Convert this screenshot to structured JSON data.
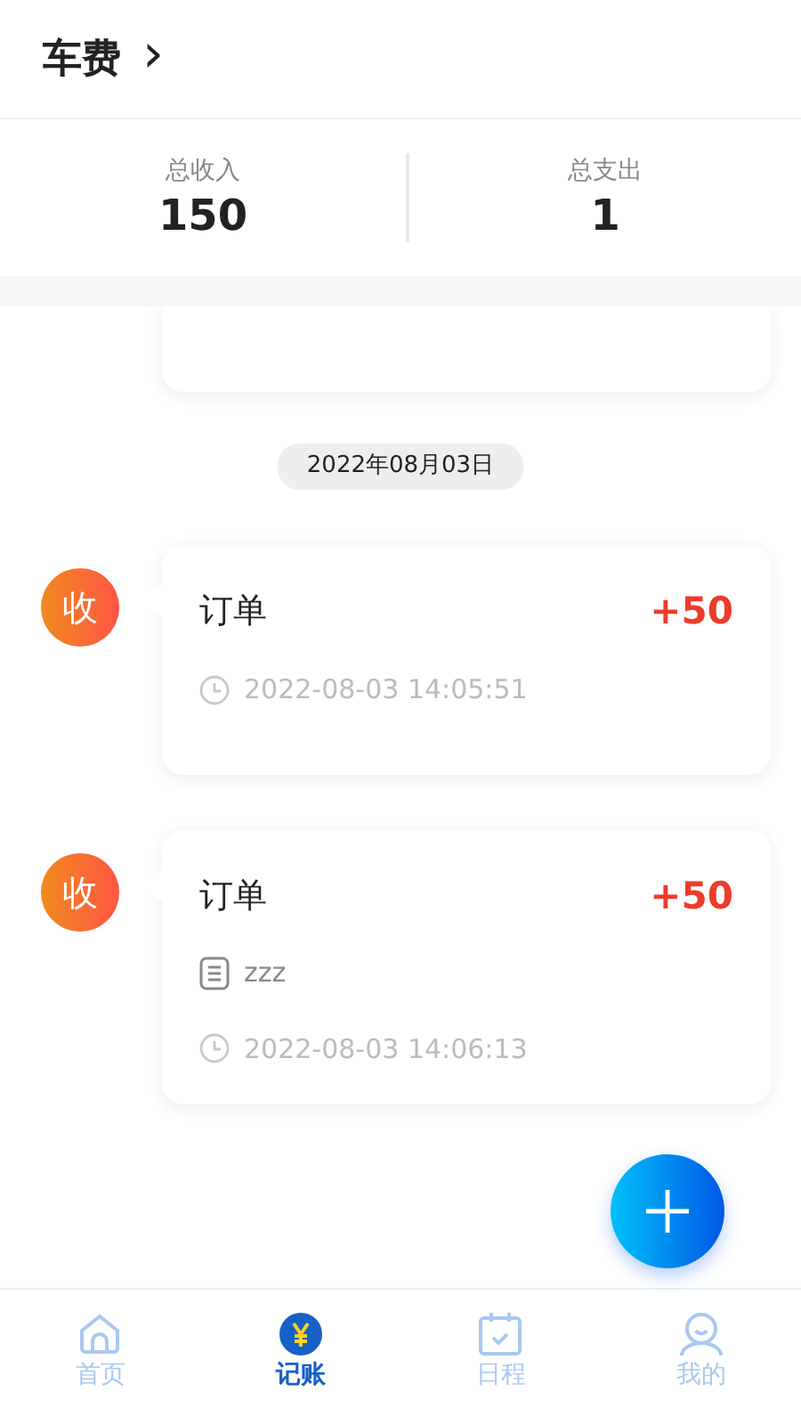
{
  "header": {
    "title": "车费",
    "chevron": "›"
  },
  "summary": [
    {
      "label": "总收入",
      "value": "150"
    },
    {
      "label": "总支出",
      "value": "1"
    }
  ],
  "date_label": "2022年08月03日",
  "records": [
    {
      "badge": "收",
      "kind": "income",
      "title": "订单",
      "amount": "+50",
      "time": "2022-08-03 14:05:51"
    },
    {
      "badge": "收",
      "kind": "income",
      "title": "订单",
      "amount": "+50",
      "note": "zzz",
      "time": "2022-08-03 14:06:13"
    }
  ],
  "tabs": [
    {
      "label": "首页",
      "kind": "home",
      "selected": false
    },
    {
      "label": "记账",
      "kind": "yen",
      "selected": true
    },
    {
      "label": "日程",
      "kind": "calendar",
      "selected": false
    },
    {
      "label": "我的",
      "kind": "user",
      "selected": false
    }
  ]
}
